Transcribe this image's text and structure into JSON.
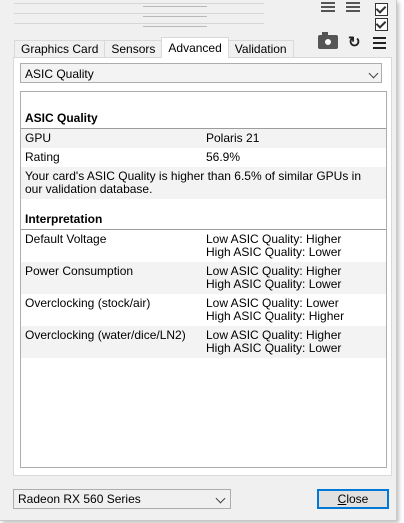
{
  "tabs": [
    {
      "label": "Graphics Card",
      "active": false
    },
    {
      "label": "Sensors",
      "active": false
    },
    {
      "label": "Advanced",
      "active": true
    },
    {
      "label": "Validation",
      "active": false
    }
  ],
  "toolbar": {
    "camera_icon": "camera-icon",
    "refresh_icon": "refresh-icon",
    "menu_icon": "hamburger-menu-icon"
  },
  "category_select": {
    "value": "ASIC Quality"
  },
  "asic_section": {
    "title": "ASIC Quality",
    "rows": [
      {
        "key": "GPU",
        "value": "Polaris 21"
      },
      {
        "key": "Rating",
        "value": "56.9%"
      }
    ],
    "note": "Your card's ASIC Quality is higher than 6.5% of similar GPUs in our validation database."
  },
  "interpretation": {
    "title": "Interpretation",
    "rows": [
      {
        "key": "Default Voltage",
        "v1": "Low ASIC Quality: Higher",
        "v2": "High ASIC Quality: Lower"
      },
      {
        "key": "Power Consumption",
        "v1": "Low ASIC Quality: Higher",
        "v2": "High ASIC Quality: Lower"
      },
      {
        "key": "Overclocking (stock/air)",
        "v1": "Low ASIC Quality: Lower",
        "v2": "High ASIC Quality: Higher"
      },
      {
        "key": "Overclocking (water/dice/LN2)",
        "v1": "Low ASIC Quality: Higher",
        "v2": "High ASIC Quality: Lower"
      }
    ]
  },
  "footer": {
    "gpu_select": "Radeon RX 560 Series",
    "close_prefix": "",
    "close_accel": "C",
    "close_rest": "lose"
  }
}
